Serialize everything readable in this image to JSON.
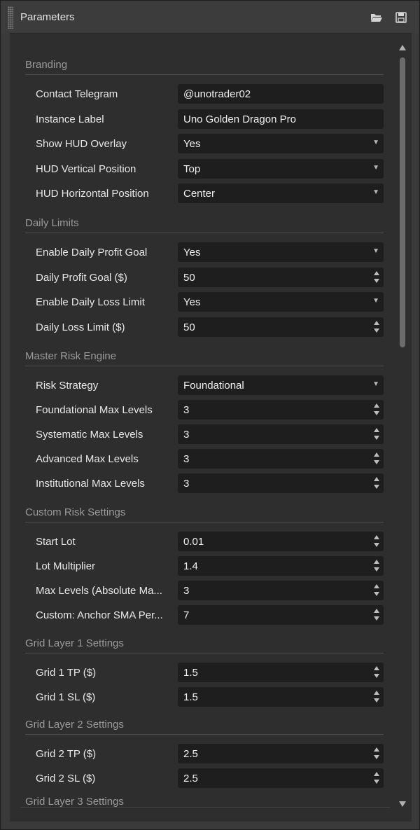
{
  "window": {
    "title": "Parameters"
  },
  "icons": {
    "open": "folder-open-icon",
    "save": "save-disk-icon"
  },
  "colors": {
    "panel_bg": "#2e2e2e",
    "field_bg": "#1e1e1e",
    "section_text": "#9a9a9a",
    "label_text": "#e8e8e8"
  },
  "sections": [
    {
      "title": "Branding",
      "rows": [
        {
          "label": "Contact Telegram",
          "value": "@unotrader02",
          "control": "text"
        },
        {
          "label": "Instance Label",
          "value": "Uno Golden Dragon Pro",
          "control": "text"
        },
        {
          "label": "Show HUD Overlay",
          "value": "Yes",
          "control": "dropdown"
        },
        {
          "label": "HUD Vertical Position",
          "value": "Top",
          "control": "dropdown"
        },
        {
          "label": "HUD Horizontal Position",
          "value": "Center",
          "control": "dropdown"
        }
      ]
    },
    {
      "title": "Daily Limits",
      "rows": [
        {
          "label": "Enable Daily Profit Goal",
          "value": "Yes",
          "control": "dropdown"
        },
        {
          "label": "Daily Profit Goal ($)",
          "value": "50",
          "control": "spinner"
        },
        {
          "label": "Enable Daily Loss Limit",
          "value": "Yes",
          "control": "dropdown"
        },
        {
          "label": "Daily Loss Limit ($)",
          "value": "50",
          "control": "spinner"
        }
      ]
    },
    {
      "title": "Master Risk Engine",
      "rows": [
        {
          "label": "Risk Strategy",
          "value": "Foundational",
          "control": "dropdown"
        },
        {
          "label": "Foundational Max Levels",
          "value": "3",
          "control": "spinner"
        },
        {
          "label": "Systematic Max Levels",
          "value": "3",
          "control": "spinner"
        },
        {
          "label": "Advanced Max Levels",
          "value": "3",
          "control": "spinner"
        },
        {
          "label": "Institutional Max Levels",
          "value": "3",
          "control": "spinner"
        }
      ]
    },
    {
      "title": "Custom Risk Settings",
      "rows": [
        {
          "label": "Start Lot",
          "value": "0.01",
          "control": "spinner"
        },
        {
          "label": "Lot Multiplier",
          "value": "1.4",
          "control": "spinner"
        },
        {
          "label": "Max Levels (Absolute Ma...",
          "value": "3",
          "control": "spinner"
        },
        {
          "label": "Custom: Anchor SMA Per...",
          "value": "7",
          "control": "spinner"
        }
      ]
    },
    {
      "title": "Grid Layer 1 Settings",
      "rows": [
        {
          "label": "Grid 1 TP ($)",
          "value": "1.5",
          "control": "spinner"
        },
        {
          "label": "Grid 1 SL ($)",
          "value": "1.5",
          "control": "spinner"
        }
      ]
    },
    {
      "title": "Grid Layer 2 Settings",
      "rows": [
        {
          "label": "Grid 2 TP ($)",
          "value": "2.5",
          "control": "spinner"
        },
        {
          "label": "Grid 2 SL ($)",
          "value": "2.5",
          "control": "spinner"
        }
      ]
    },
    {
      "title": "Grid Layer 3 Settings",
      "rows": []
    }
  ]
}
